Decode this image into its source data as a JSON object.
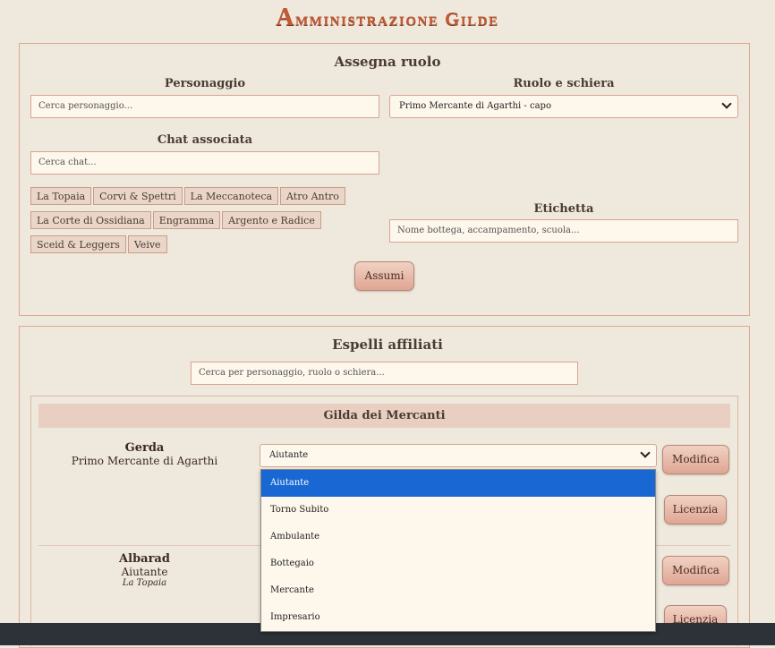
{
  "header": {
    "title_first": "A",
    "title_rest": "mministrazione Gilde"
  },
  "assign": {
    "heading": "Assegna ruolo",
    "character_label": "Personaggio",
    "character_placeholder": "Cerca personaggio...",
    "role_label": "Ruolo e schiera",
    "role_value": "Primo Mercante di Agarthi - capo",
    "chat_label": "Chat associata",
    "chat_placeholder": "Cerca chat...",
    "chat_tags": [
      "La Topaia",
      "Corvi & Spettri",
      "La Meccanoteca",
      "Atro Antro",
      "La Corte di Ossidiana",
      "Engramma",
      "Argento e Radice",
      "Sceid & Leggers",
      "Veive"
    ],
    "tag_label": "Etichetta",
    "tag_placeholder": "Nome bottega, accampamento, scuola...",
    "submit_label": "Assumi"
  },
  "affiliates": {
    "heading": "Espelli affiliati",
    "search_placeholder": "Cerca per personaggio, ruolo o schiera...",
    "group_name": "Gilda dei Mercanti",
    "members": [
      {
        "name": "Gerda",
        "role": "Primo Mercante di Agarthi",
        "chat": "",
        "select_value": "Aiutante"
      },
      {
        "name": "Albarad",
        "role": "Aiutante",
        "chat": "La Topaia"
      }
    ],
    "modify_label": "Modifica",
    "dismiss_label": "Licenzia"
  },
  "dropdown": {
    "options": [
      "Aiutante",
      "Torno Subito",
      "Ambulante",
      "Bottegaio",
      "Mercante",
      "Impresario"
    ],
    "selected": "Aiutante"
  }
}
